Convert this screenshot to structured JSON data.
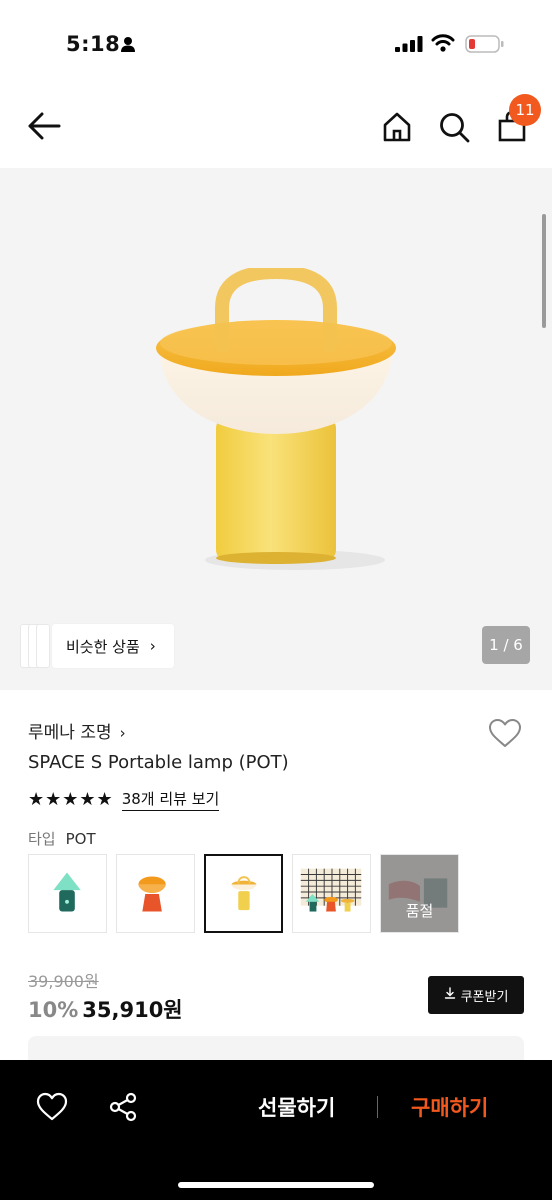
{
  "status_bar": {
    "time": "5:18",
    "icons": [
      "person-icon",
      "signal-icon",
      "wifi-icon",
      "battery-low-icon"
    ],
    "battery_color": "#e53935"
  },
  "header": {
    "icons": [
      "back-arrow-icon",
      "home-icon",
      "search-icon",
      "cart-icon"
    ],
    "cart_count": "11",
    "accent": "#f2591e"
  },
  "gallery": {
    "similar_label": "비슷한 상품",
    "similar_chevron": "›",
    "pager": "1 / 6"
  },
  "product": {
    "brand": "루메나 조명",
    "brand_chevron": "›",
    "name": "SPACE S Portable lamp (POT)",
    "stars": "★★★★★",
    "rating": 5,
    "reviews_link": "38개 리뷰 보기",
    "type_label": "타입",
    "type_value": "POT",
    "options": [
      {
        "name": "green-lamp",
        "selected": false,
        "sold_out": false
      },
      {
        "name": "orange-lamp",
        "selected": false,
        "sold_out": false
      },
      {
        "name": "pot-lamp",
        "selected": true,
        "sold_out": false
      },
      {
        "name": "set-lamp",
        "selected": false,
        "sold_out": false
      },
      {
        "name": "red-lamp",
        "selected": false,
        "sold_out": true
      }
    ],
    "sold_out_label": "품절",
    "original_price": "39,900원",
    "discount": "10%",
    "sale_price": "35,910원",
    "coupon_label": "쿠폰받기"
  },
  "bottom_bar": {
    "icons": [
      "heart-icon",
      "share-icon"
    ],
    "gift_label": "선물하기",
    "buy_label": "구매하기",
    "buy_color": "#f2591e"
  }
}
